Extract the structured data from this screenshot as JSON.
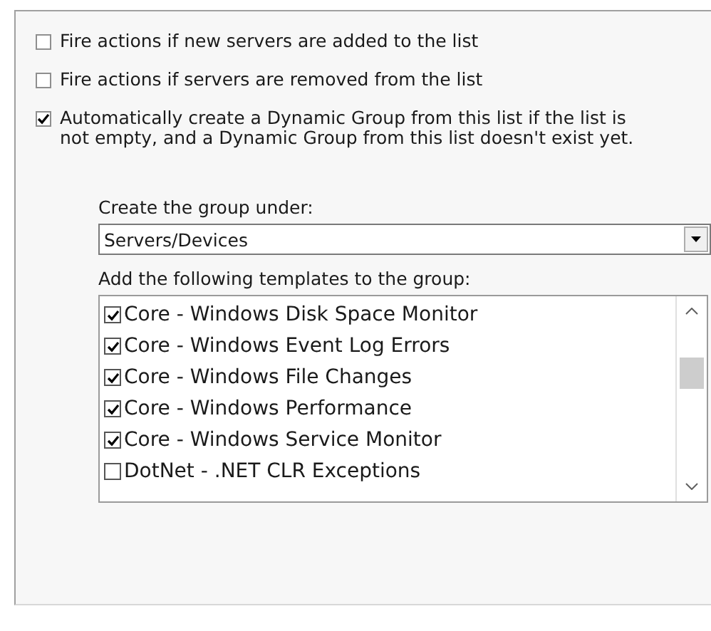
{
  "options": [
    {
      "label": "Fire actions if new servers are added to the list",
      "checked": false
    },
    {
      "label": "Fire actions if servers are removed from the list",
      "checked": false
    },
    {
      "label": "Automatically create a Dynamic Group from this list if the list is not empty, and a Dynamic Group from this list doesn't exist yet.",
      "checked": true
    }
  ],
  "group_under": {
    "label": "Create the group under:",
    "value": "Servers/Devices"
  },
  "templates": {
    "label": "Add the following templates to the group:",
    "items": [
      {
        "label": "Core - Windows Disk Space Monitor",
        "checked": true
      },
      {
        "label": "Core - Windows Event Log Errors",
        "checked": true
      },
      {
        "label": "Core - Windows File Changes",
        "checked": true
      },
      {
        "label": "Core - Windows Performance",
        "checked": true
      },
      {
        "label": "Core - Windows Service Monitor",
        "checked": true
      },
      {
        "label": "DotNet - .NET CLR Exceptions",
        "checked": false
      }
    ]
  }
}
